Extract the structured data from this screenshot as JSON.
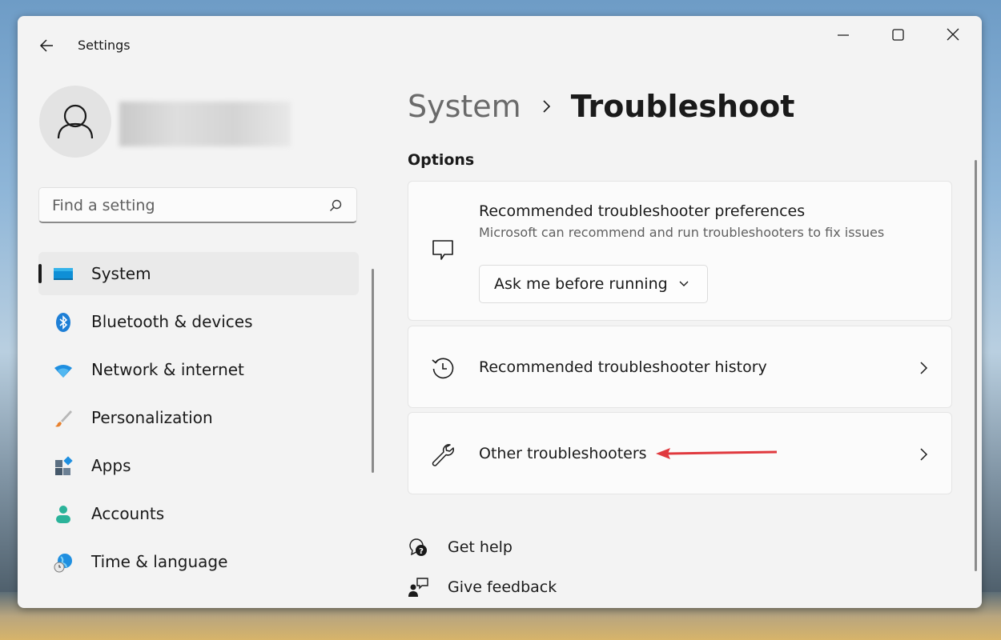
{
  "window": {
    "title": "Settings"
  },
  "search": {
    "placeholder": "Find a setting"
  },
  "sidebar": {
    "items": [
      {
        "label": "System",
        "icon": "system-icon",
        "active": true
      },
      {
        "label": "Bluetooth & devices",
        "icon": "bluetooth-icon"
      },
      {
        "label": "Network & internet",
        "icon": "wifi-icon"
      },
      {
        "label": "Personalization",
        "icon": "brush-icon"
      },
      {
        "label": "Apps",
        "icon": "apps-icon"
      },
      {
        "label": "Accounts",
        "icon": "person-icon"
      },
      {
        "label": "Time & language",
        "icon": "globe-clock-icon"
      }
    ]
  },
  "breadcrumb": {
    "parent": "System",
    "current": "Troubleshoot"
  },
  "section": {
    "heading": "Options"
  },
  "cards": {
    "preferences": {
      "title": "Recommended troubleshooter preferences",
      "description": "Microsoft can recommend and run troubleshooters to fix issues",
      "dropdown_value": "Ask me before running",
      "icon": "chat-bubble-icon"
    },
    "history": {
      "title": "Recommended troubleshooter history",
      "icon": "history-icon"
    },
    "other": {
      "title": "Other troubleshooters",
      "icon": "wrench-icon"
    }
  },
  "footer": {
    "get_help": "Get help",
    "give_feedback": "Give feedback"
  },
  "colors": {
    "accent": "#0067c0",
    "annotation_arrow": "#e0393e"
  }
}
